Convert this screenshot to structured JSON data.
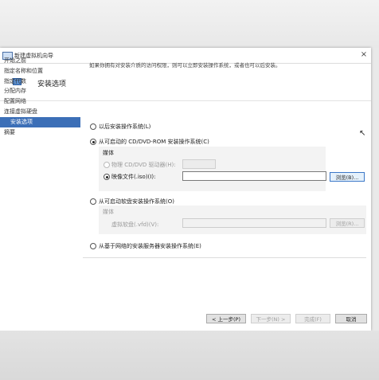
{
  "window": {
    "title": "新建虚拟机向导",
    "close_glyph": "×"
  },
  "header": {
    "title": "安装选项"
  },
  "nav": {
    "items": [
      {
        "label": "开始之前"
      },
      {
        "label": "指定名称和位置"
      },
      {
        "label": "指定代数"
      },
      {
        "label": "分配内存"
      },
      {
        "label": "配置网络"
      },
      {
        "label": "连接虚拟硬盘"
      },
      {
        "label": "安装选项"
      },
      {
        "label": "摘要"
      }
    ]
  },
  "intro": "如果你拥有对安装介质的访问权限，则可以立即安装操作系统，或者也可以后安装。",
  "options": {
    "later": "以后安装操作系统(L)",
    "cd": "从可启动的 CD/DVD-ROM 安装操作系统(C)",
    "floppy": "从可启动软盘安装操作系统(O)",
    "network": "从基于网络的安装服务器安装操作系统(E)"
  },
  "cd_group": {
    "media_label": "媒体",
    "physical_drive": "物理 CD/DVD 驱动器(H):",
    "image_file": "映像文件(.iso)(I):",
    "image_value": "",
    "browse": "浏览(B)..."
  },
  "floppy_group": {
    "media_label": "媒体",
    "vfd_label": "虚拟软盘(.vfd)(V):",
    "vfd_value": "",
    "browse": "浏览(R)..."
  },
  "buttons": {
    "prev": "< 上一步(P)",
    "next": "下一步(N) >",
    "finish": "完成(F)",
    "cancel": "取消"
  }
}
